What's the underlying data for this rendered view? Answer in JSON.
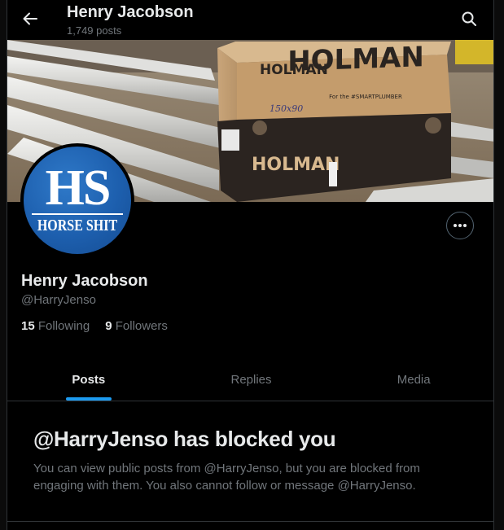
{
  "header": {
    "name": "Henry Jacobson",
    "posts_count": "1,749 posts",
    "back_icon": "arrow-left-icon",
    "search_icon": "search-icon"
  },
  "banner": {
    "box_brand_front": "HOLMAN",
    "box_brand_side": "HOLMAN",
    "box_slogan": "For the #SMARTPLUMBER",
    "box_handwriting": "150x90"
  },
  "avatar": {
    "logo_text": "HS",
    "logo_subtext": "HORSE SHIT"
  },
  "profile": {
    "display_name": "Henry Jacobson",
    "handle": "@HarryJenso",
    "following_count": "15",
    "following_label": "Following",
    "followers_count": "9",
    "followers_label": "Followers"
  },
  "tabs": [
    {
      "label": "Posts",
      "active": true
    },
    {
      "label": "Replies",
      "active": false
    },
    {
      "label": "Media",
      "active": false
    }
  ],
  "blocked": {
    "title": "@HarryJenso has blocked you",
    "message": "You can view public posts from @HarryJenso, but you are blocked from engaging with them. You also cannot follow or message @HarryJenso."
  },
  "colors": {
    "accent": "#1d9bf0",
    "background": "#000000",
    "muted_text": "#71767b",
    "primary_text": "#e7e9ea",
    "avatar_blue": "#1d5fae"
  }
}
